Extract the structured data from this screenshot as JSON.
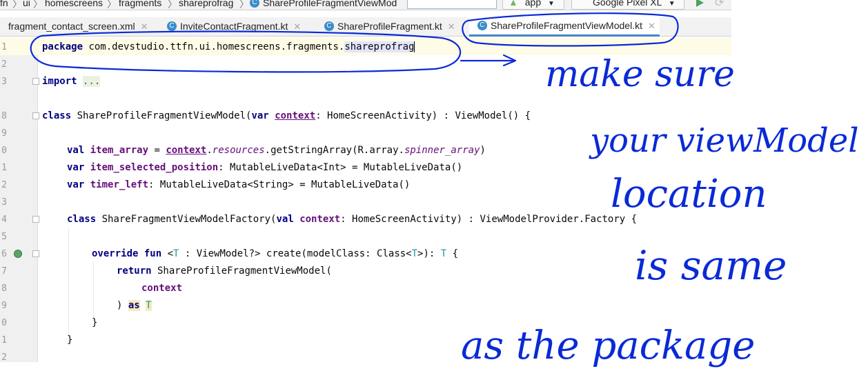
{
  "breadcrumb": {
    "items": [
      "fn",
      "ui",
      "homescreens",
      "fragments",
      "shareprofrag",
      "ShareProfileFragmentViewMod"
    ],
    "separator": "〉"
  },
  "toolbar": {
    "run_config": "app",
    "device": "Google Pixel XL"
  },
  "tabs": [
    {
      "label": "fragment_contact_screen.xml",
      "active": false
    },
    {
      "label": "InviteContactFragment.kt",
      "active": false
    },
    {
      "label": "ShareProfileFragment.kt",
      "active": false
    },
    {
      "label": "ShareProfileFragmentViewModel.kt",
      "active": true
    }
  ],
  "gutter": {
    "line_numbers": [
      "1",
      "2",
      "3",
      "8",
      "9",
      "0",
      "1",
      "2",
      "3",
      "4",
      "5",
      "6",
      "7",
      "8",
      "9",
      "0",
      "1",
      "2"
    ]
  },
  "code": {
    "l1_kw": "package",
    "l1_pkg": " com.devstudio.ttfn.ui.homescreens.fragments.",
    "l1_last": "shareprofrag",
    "l3_kw": "import",
    "l3_dots": "...",
    "l8_kw": "class",
    "l8_a": " ShareProfileFragmentViewModel(",
    "l8_kw2": "var",
    "l8_ctx": "context",
    "l8_b": ": HomeScreenActivity) : ViewModel() {",
    "l10_kw": "val",
    "l10_prop": "item_array",
    "l10_a": " = ",
    "l10_ctx": "context",
    "l10_b": ".",
    "l10_res": "resources",
    "l10_c": ".getStringArray(R.array.",
    "l10_arr": "spinner_array",
    "l10_d": ")",
    "l11_kw": "var",
    "l11_prop": "item_selected_position",
    "l11_a": ": MutableLiveData<Int> = MutableLiveData()",
    "l12_kw": "var",
    "l12_prop": "timer_left",
    "l12_a": ": MutableLiveData<String> = MutableLiveData()",
    "l14_kw": "class",
    "l14_a": " ShareFragmentViewModelFactory(",
    "l14_kw2": "val",
    "l14_ctx": "context",
    "l14_b": ": HomeScreenActivity) : ViewModelProvider.Factory {",
    "l16_kw": "override fun",
    "l16_a": " <",
    "l16_t1": "T",
    "l16_b": " : ViewModel?> create(modelClass: Class<",
    "l16_t2": "T",
    "l16_c": ">): ",
    "l16_t3": "T",
    "l16_d": " {",
    "l17_kw": "return",
    "l17_a": " ShareProfileFragmentViewModel(",
    "l18_ctx": "context",
    "l19_a": ") ",
    "l19_as": "as",
    "l19_t": "T",
    "l20": "}",
    "l21": "}"
  },
  "handwriting": {
    "line1": "make sure",
    "line2": "your viewModel",
    "line3": "location",
    "line4": "is same",
    "line5": "as the package"
  },
  "colors": {
    "annotation_ink": "#0a2ad6",
    "keyword": "#000080",
    "property": "#660e7a",
    "type_param": "#20999d",
    "active_tab_underline": "#4083c9"
  }
}
